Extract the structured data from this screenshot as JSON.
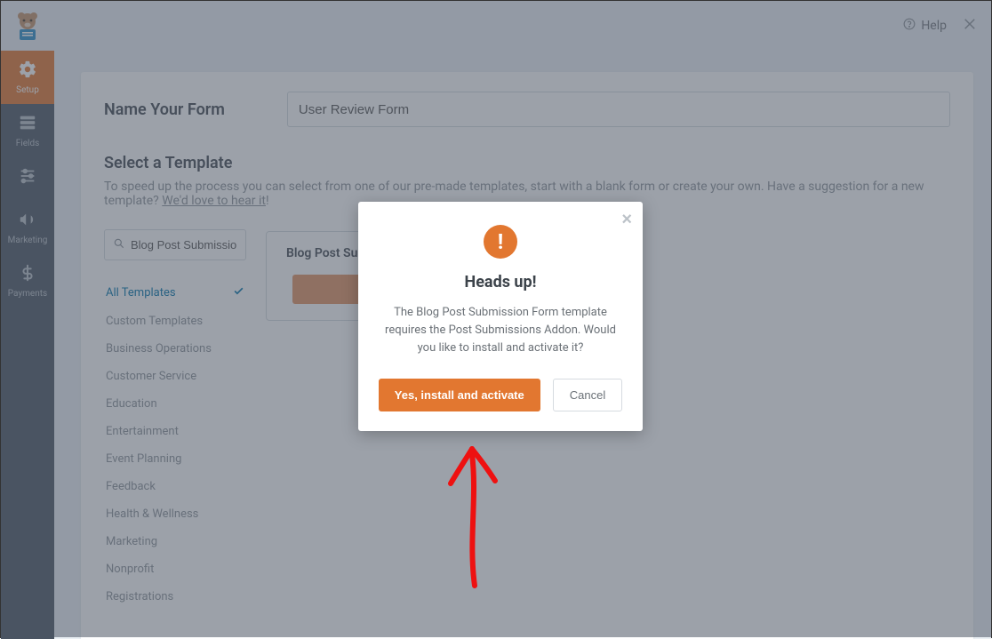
{
  "topbar": {
    "help_label": "Help"
  },
  "sidebar": {
    "items": [
      {
        "label": "Setup"
      },
      {
        "label": "Fields"
      },
      {
        "label": "Settings"
      },
      {
        "label": "Marketing"
      },
      {
        "label": "Payments"
      }
    ]
  },
  "form": {
    "name_label": "Name Your Form",
    "name_value": "User Review Form",
    "select_title": "Select a Template",
    "select_desc_prefix": "To speed up the process you can select from one of our pre-made templates, start with a blank form or create your own. Have a suggestion for a new template? ",
    "select_desc_link": "We'd love to hear it",
    "select_desc_suffix": "!"
  },
  "search": {
    "value": "Blog Post Submission"
  },
  "categories": [
    {
      "label": "All Templates",
      "active": true
    },
    {
      "label": "Custom Templates",
      "active": false
    },
    {
      "label": "Business Operations",
      "active": false
    },
    {
      "label": "Customer Service",
      "active": false
    },
    {
      "label": "Education",
      "active": false
    },
    {
      "label": "Entertainment",
      "active": false
    },
    {
      "label": "Event Planning",
      "active": false
    },
    {
      "label": "Feedback",
      "active": false
    },
    {
      "label": "Health & Wellness",
      "active": false
    },
    {
      "label": "Marketing",
      "active": false
    },
    {
      "label": "Nonprofit",
      "active": false
    },
    {
      "label": "Registrations",
      "active": false
    }
  ],
  "template_card": {
    "title": "Blog Post Submission Form"
  },
  "modal": {
    "title": "Heads up!",
    "text": "The Blog Post Submission Form template requires the Post Submissions Addon. Would you like to install and activate it?",
    "primary": "Yes, install and activate",
    "secondary": "Cancel"
  }
}
